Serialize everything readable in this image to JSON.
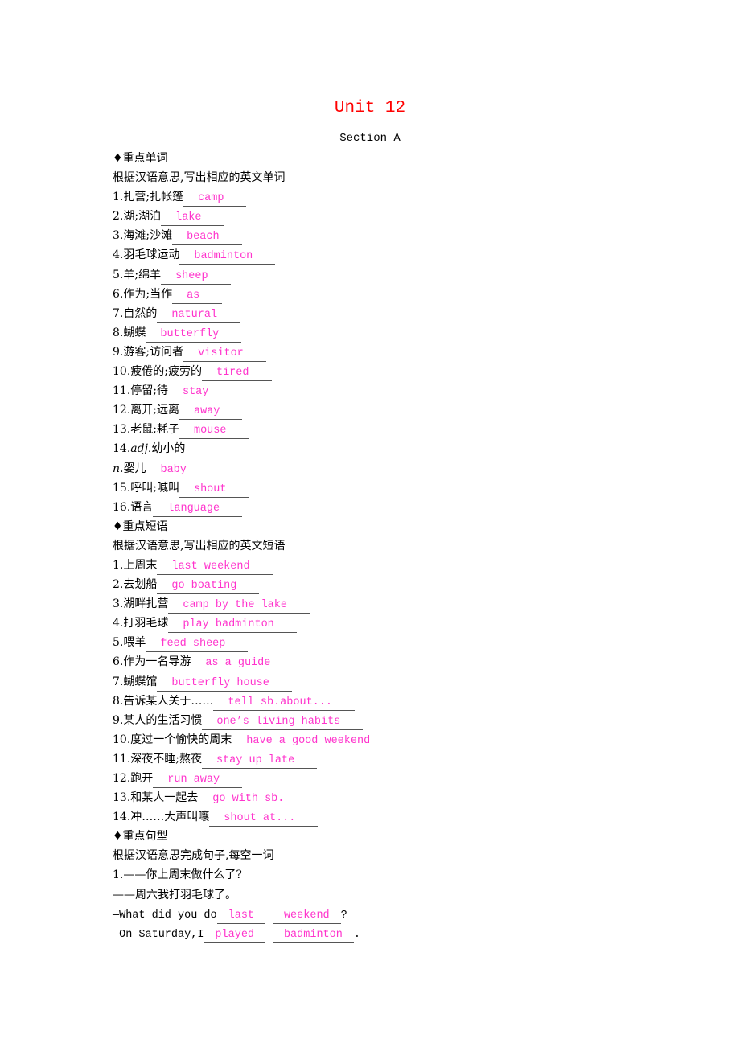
{
  "header": {
    "title": "Unit 12",
    "subtitle": "Section A"
  },
  "sections": {
    "words": {
      "heading": "♦重点单词",
      "instruction": "根据汉语意思,写出相应的英文单词",
      "items": [
        {
          "num": "1.",
          "prompt": "扎营;扎帐篷",
          "answer": "camp"
        },
        {
          "num": "2.",
          "prompt": "湖;湖泊",
          "answer": "lake"
        },
        {
          "num": "3.",
          "prompt": "海滩;沙滩",
          "answer": "beach"
        },
        {
          "num": "4.",
          "prompt": "羽毛球运动",
          "answer": "badminton"
        },
        {
          "num": "5.",
          "prompt": "羊;绵羊",
          "answer": "sheep"
        },
        {
          "num": "6.",
          "prompt": "作为;当作",
          "answer": "as"
        },
        {
          "num": "7.",
          "prompt": "自然的",
          "answer": "natural"
        },
        {
          "num": "8.",
          "prompt": "蝴蝶",
          "answer": "butterfly"
        },
        {
          "num": "9.",
          "prompt": "游客;访问者",
          "answer": "visitor"
        },
        {
          "num": "10.",
          "prompt": "疲倦的;疲劳的",
          "answer": "tired"
        },
        {
          "num": "11.",
          "prompt": "停留;待",
          "answer": "stay"
        },
        {
          "num": "12.",
          "prompt": "离开;远离",
          "answer": "away"
        },
        {
          "num": "13.",
          "prompt": "老鼠;耗子",
          "answer": "mouse"
        }
      ],
      "item14": {
        "num": "14.",
        "pos1": "adj.",
        "prompt1": "幼小的",
        "pos2": "n.",
        "prompt2": "婴儿",
        "answer": "baby"
      },
      "items_tail": [
        {
          "num": "15.",
          "prompt": "呼叫;喊叫",
          "answer": "shout"
        },
        {
          "num": "16.",
          "prompt": "语言",
          "answer": "language"
        }
      ]
    },
    "phrases": {
      "heading": "♦重点短语",
      "instruction": "根据汉语意思,写出相应的英文短语",
      "items": [
        {
          "num": "1.",
          "prompt": "上周末",
          "answer": "last weekend"
        },
        {
          "num": "2.",
          "prompt": "去划船",
          "answer": "go boating"
        },
        {
          "num": "3.",
          "prompt": "湖畔扎营",
          "answer": "camp by the lake"
        },
        {
          "num": "4.",
          "prompt": "打羽毛球",
          "answer": "play badminton"
        },
        {
          "num": "5.",
          "prompt": "喂羊",
          "answer": "feed sheep"
        },
        {
          "num": "6.",
          "prompt": "作为一名导游",
          "answer": "as a guide"
        },
        {
          "num": "7.",
          "prompt": "蝴蝶馆",
          "answer": "butterfly house"
        },
        {
          "num": "8.",
          "prompt": "告诉某人关于……",
          "answer": "tell sb.about..."
        },
        {
          "num": "9.",
          "prompt": "某人的生活习惯",
          "answer": "one’s living habits"
        },
        {
          "num": "10.",
          "prompt": "度过一个愉快的周末",
          "answer": "have a good weekend"
        },
        {
          "num": "11.",
          "prompt": "深夜不睡;熬夜",
          "answer": "stay up late"
        },
        {
          "num": "12.",
          "prompt": "跑开",
          "answer": "run away"
        },
        {
          "num": "13.",
          "prompt": "和某人一起去",
          "answer": "go with sb."
        },
        {
          "num": "14.",
          "prompt": "冲……大声叫嚷",
          "answer": "shout at..."
        }
      ]
    },
    "sentences": {
      "heading": "♦重点句型",
      "instruction": "根据汉语意思完成句子,每空一词",
      "q1": {
        "zh_q": "1.——你上周末做什么了?",
        "zh_a": "——周六我打羽毛球了。",
        "en_q_prefix": "—What did you do",
        "en_q_answers": [
          "last",
          "weekend"
        ],
        "en_q_suffix": "?",
        "en_a_prefix": "—On Saturday,I",
        "en_a_answers": [
          "played",
          "badminton"
        ],
        "en_a_suffix": "."
      }
    }
  },
  "colors": {
    "title": "#ff0000",
    "answer": "#ff33cc"
  }
}
